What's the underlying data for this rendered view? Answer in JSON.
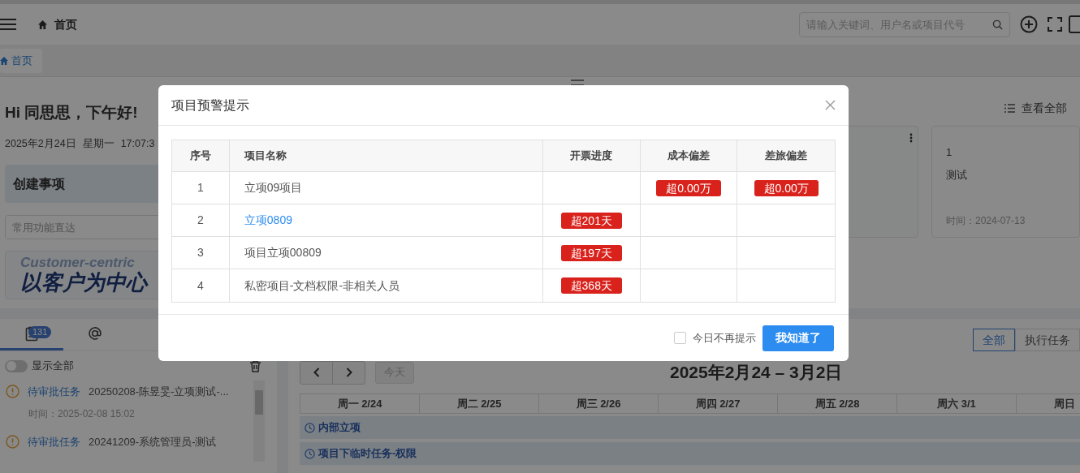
{
  "header": {
    "home": "首页",
    "search_placeholder": "请输入关键词、用户名或项目代号"
  },
  "tabs": [
    {
      "label": "首页",
      "selected": true
    }
  ],
  "greeting": "Hi 同思思，下午好!",
  "date": {
    "day": "2025年2月24日",
    "weekday": "星期一",
    "time": "17:07:3"
  },
  "create_title": "创建事项",
  "quick_placeholder": "常用功能直达",
  "banner": {
    "subtitle": "Customer-centric",
    "title": "以客户为中心"
  },
  "view_all": "查看全部",
  "cards": [
    {
      "line_1": "1",
      "line_2": "测试",
      "time": "时间：2024-07-13"
    }
  ],
  "tasks_panel": {
    "tabs": [
      {
        "kind": "tasks",
        "badge": "131",
        "selected": true
      },
      {
        "kind": "mentions",
        "selected": false
      }
    ],
    "show_all": {
      "label": "显示全部",
      "on": false
    },
    "items": [
      {
        "type": "待审批任务",
        "title": "20250208-陈昱旻-立项测试-...",
        "time": "时间：2025-02-08 15:02"
      },
      {
        "type": "待审批任务",
        "title": "20241209-系统管理员-测试"
      }
    ]
  },
  "calendar": {
    "filters": [
      {
        "label": "全部",
        "selected": true
      },
      {
        "label": "执行任务",
        "selected": false
      }
    ],
    "today": {
      "label": "今天",
      "disabled": true
    },
    "range": "2025年2月24 – 3月2日",
    "days": [
      "周一 2/24",
      "周二 2/25",
      "周三 2/26",
      "周四 2/27",
      "周五 2/28",
      "周六 3/1",
      "周日"
    ],
    "events": [
      "内部立项",
      "项目下临时任务-权限"
    ]
  },
  "modal": {
    "title": "项目预警提示",
    "columns": [
      "序号",
      "项目名称",
      "开票进度",
      "成本偏差",
      "差旅偏差"
    ],
    "rows": [
      {
        "index": "1",
        "name": "立项09项目",
        "link": false,
        "cost": "超0.00万",
        "travel": "超0.00万"
      },
      {
        "index": "2",
        "name": "立项0809",
        "link": true,
        "invoice": "超201天"
      },
      {
        "index": "3",
        "name": "项目立项00809",
        "link": false,
        "invoice": "超197天"
      },
      {
        "index": "4",
        "name": "私密项目-文档权限-非相关人员",
        "link": false,
        "invoice": "超368天"
      }
    ],
    "dont_remind": {
      "label": "今日不再提示",
      "checked": false
    },
    "confirm": "我知道了"
  }
}
